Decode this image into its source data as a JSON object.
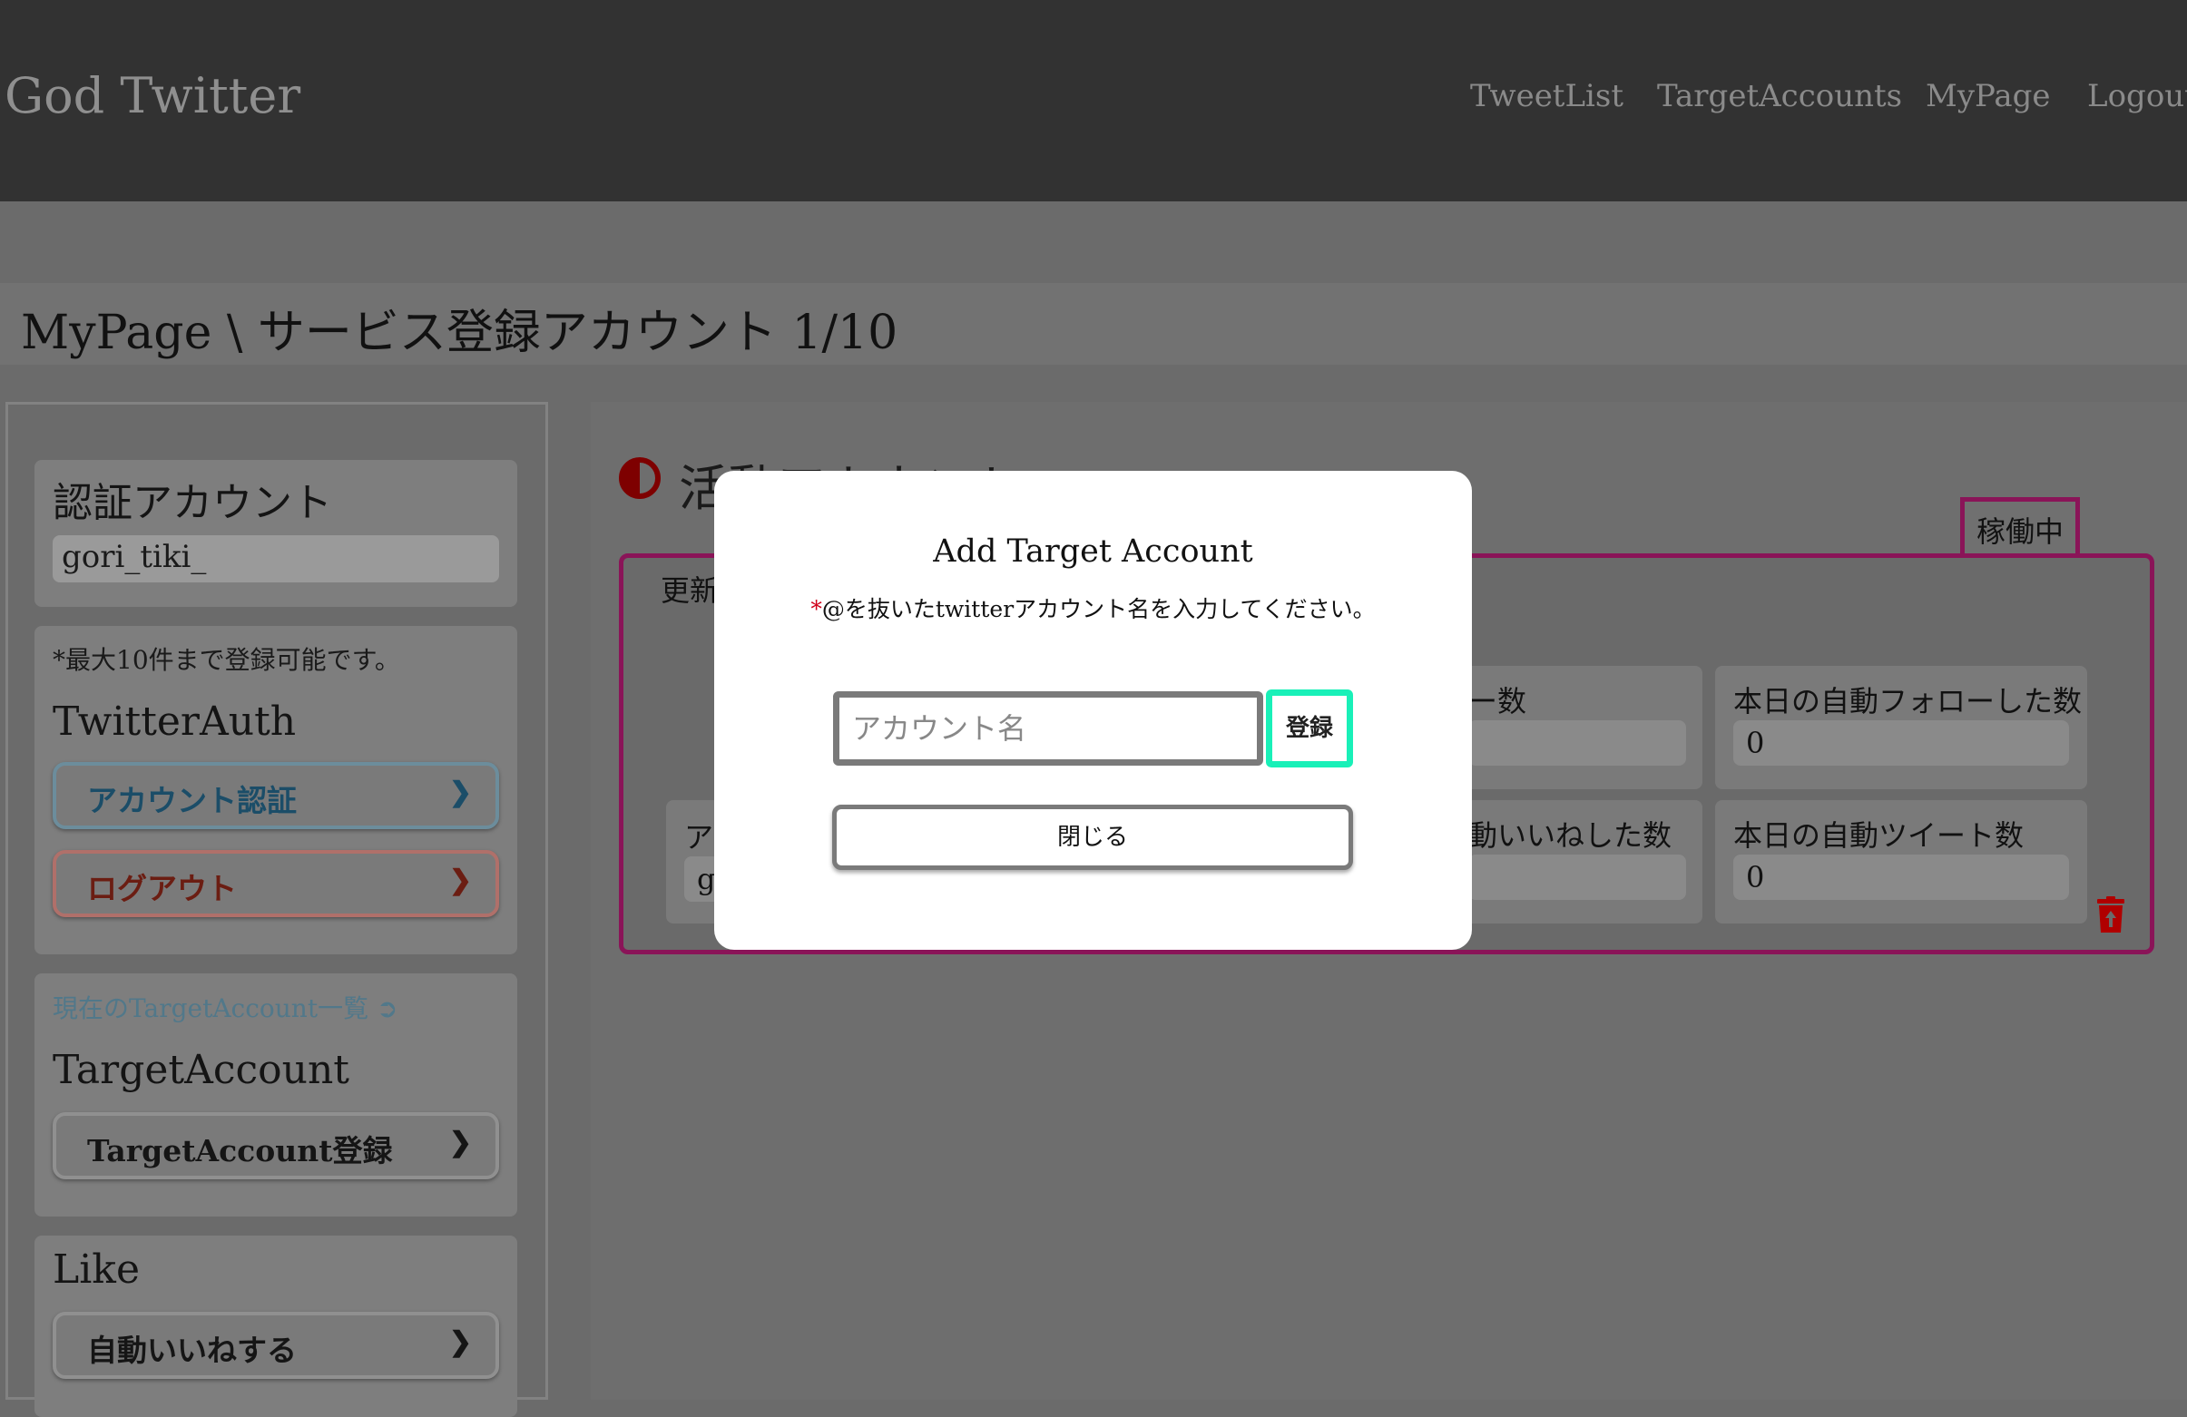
{
  "header": {
    "logo": "God Twitter",
    "nav": [
      "TweetList",
      "TargetAccounts",
      "MyPage",
      "Logout"
    ]
  },
  "breadcrumb": "MyPage \\ サービス登録アカウント 1/10",
  "sidebar": {
    "auth_card": {
      "title": "認証アカウント",
      "account": "gori_tiki_"
    },
    "twitter_auth": {
      "note": "*最大10件まで登録可能です。",
      "title": "TwitterAuth",
      "auth_button": "アカウント認証",
      "logout_button": "ログアウト"
    },
    "target_account": {
      "link": "現在のTargetAccount一覧",
      "title": "TargetAccount",
      "register_button": "TargetAccount登録"
    },
    "like": {
      "title": "Like",
      "button": "自動いいねする"
    }
  },
  "main": {
    "section_title": "活動アカウント",
    "status_tab": "稼働中",
    "updated_label": "更新",
    "account_label": "ア",
    "account_value": "go",
    "stats": [
      {
        "label": "ー数",
        "value": ""
      },
      {
        "label": "本日の自動フォローした数",
        "value": "0"
      },
      {
        "label": "動いいねした数",
        "value": ""
      },
      {
        "label": "本日の自動ツイート数",
        "value": "0"
      }
    ]
  },
  "modal": {
    "title": "Add Target Account",
    "required_mark": "*",
    "help": "@を抜いたtwitterアカウント名を入力してください。",
    "input_placeholder": "アカウント名",
    "register_button": "登録",
    "close_button": "閉じる"
  },
  "colors": {
    "accent_border": "#8a1458",
    "register_highlight": "#19f0b8",
    "required": "#d0021b"
  }
}
